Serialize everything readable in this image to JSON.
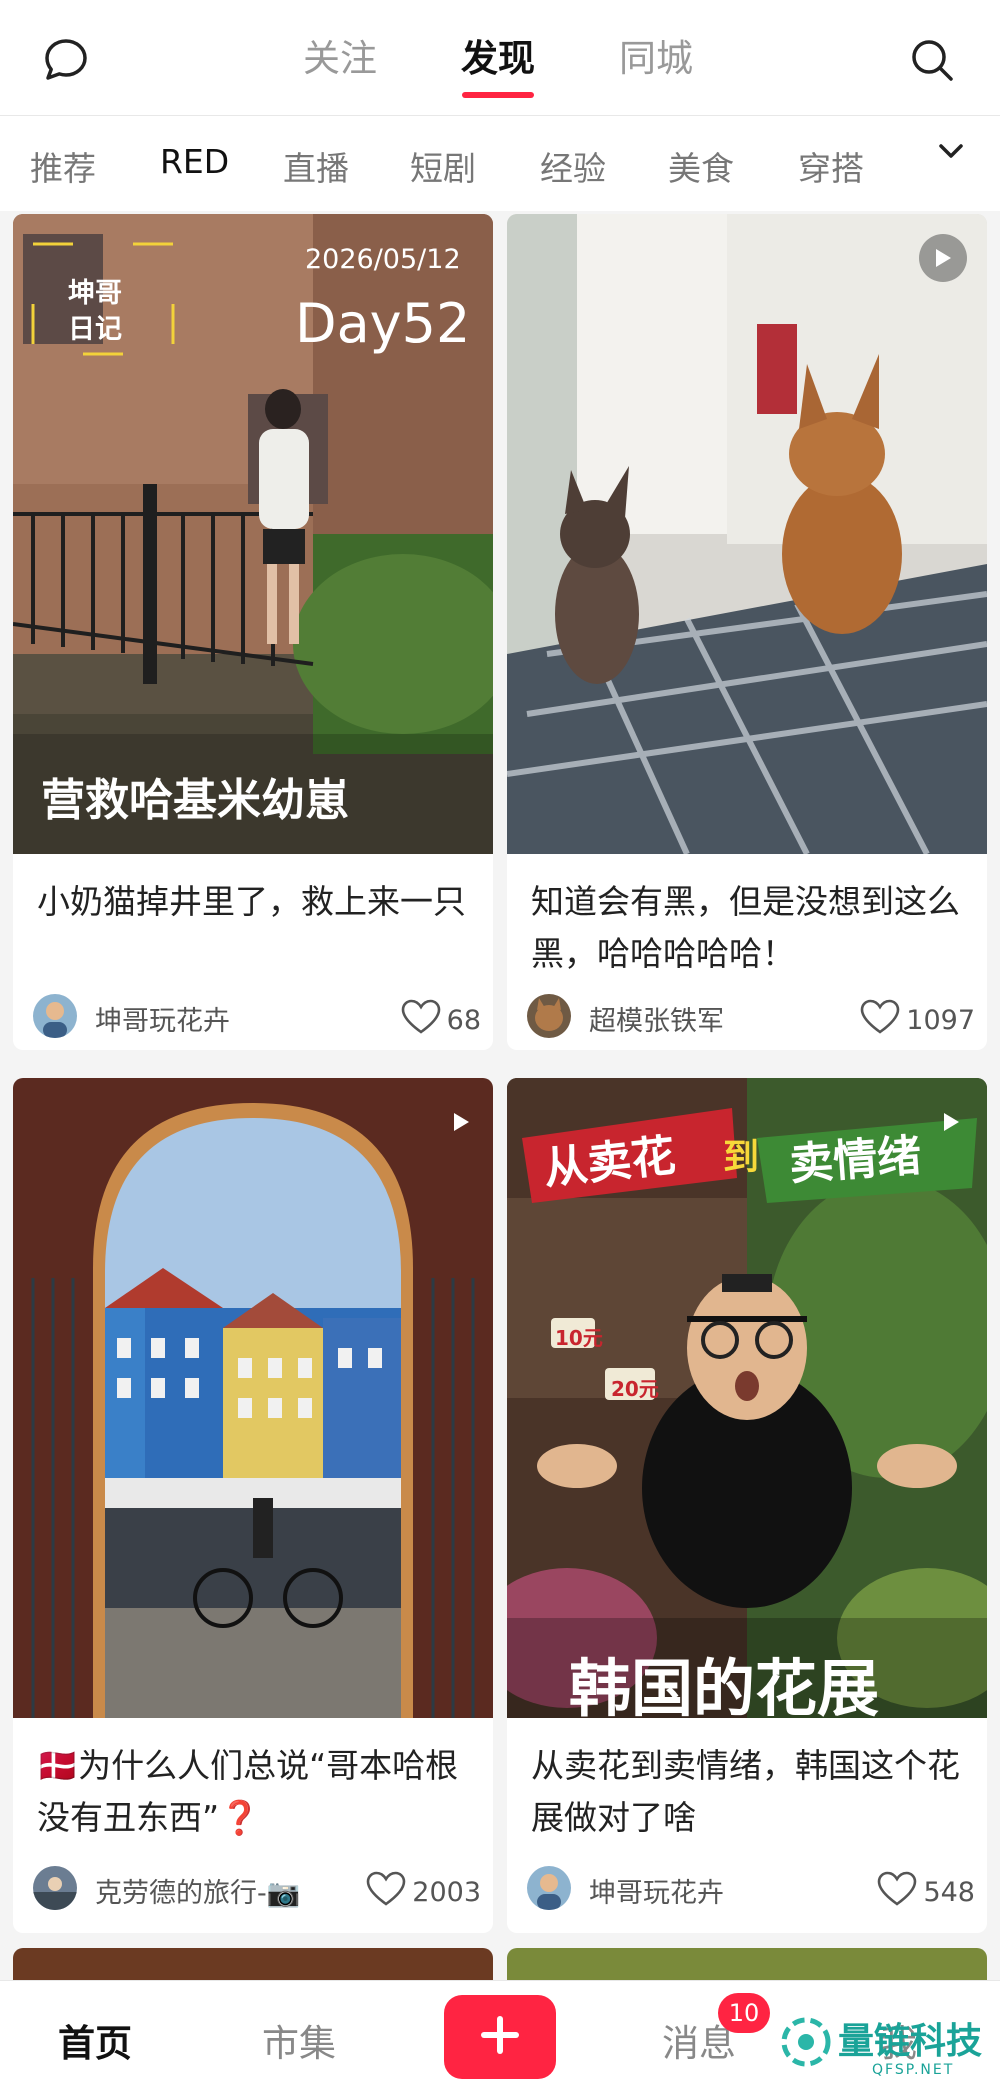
{
  "top_nav": {
    "tabs": [
      "关注",
      "发现",
      "同城"
    ],
    "active_tab": "发现"
  },
  "categories": {
    "items": [
      "推荐",
      "RED",
      "直播",
      "短剧",
      "经验",
      "美食",
      "穿搭"
    ],
    "selected": "RED"
  },
  "feed": [
    {
      "overlay_brand": "坤哥\n日记",
      "overlay_date": "2026/05/12",
      "overlay_day": "Day52",
      "overlay_caption": "营救哈基米幼崽",
      "title": "小奶猫掉井里了，救上来一只",
      "author": "坤哥玩花卉",
      "likes": "68"
    },
    {
      "title": "知道会有黑，但是没想到这么黑，哈哈哈哈哈！",
      "author": "超模张铁军",
      "likes": "1097"
    },
    {
      "title": "🇩🇰为什么人们总说“哥本哈根没有丑东西”❓",
      "author": "克劳德的旅行-📷",
      "likes": "2003"
    },
    {
      "overlay_top_left": "从卖花",
      "overlay_top_mid": "到",
      "overlay_top_right": "卖情绪",
      "overlay_price_1": "10元",
      "overlay_price_2": "20元",
      "overlay_bottom": "韩国的花展",
      "title": "从卖花到卖情绪，韩国这个花展做对了啥",
      "author": "坤哥玩花卉",
      "likes": "548"
    }
  ],
  "bottom_nav": {
    "items": [
      "首页",
      "市集",
      "消息",
      "我"
    ],
    "active": "首页",
    "message_badge": "10"
  },
  "watermark": {
    "text": "量链科技",
    "sub": "QFSP.NET"
  },
  "colors": {
    "accent": "#ff2442",
    "background": "#f4f4f4"
  }
}
